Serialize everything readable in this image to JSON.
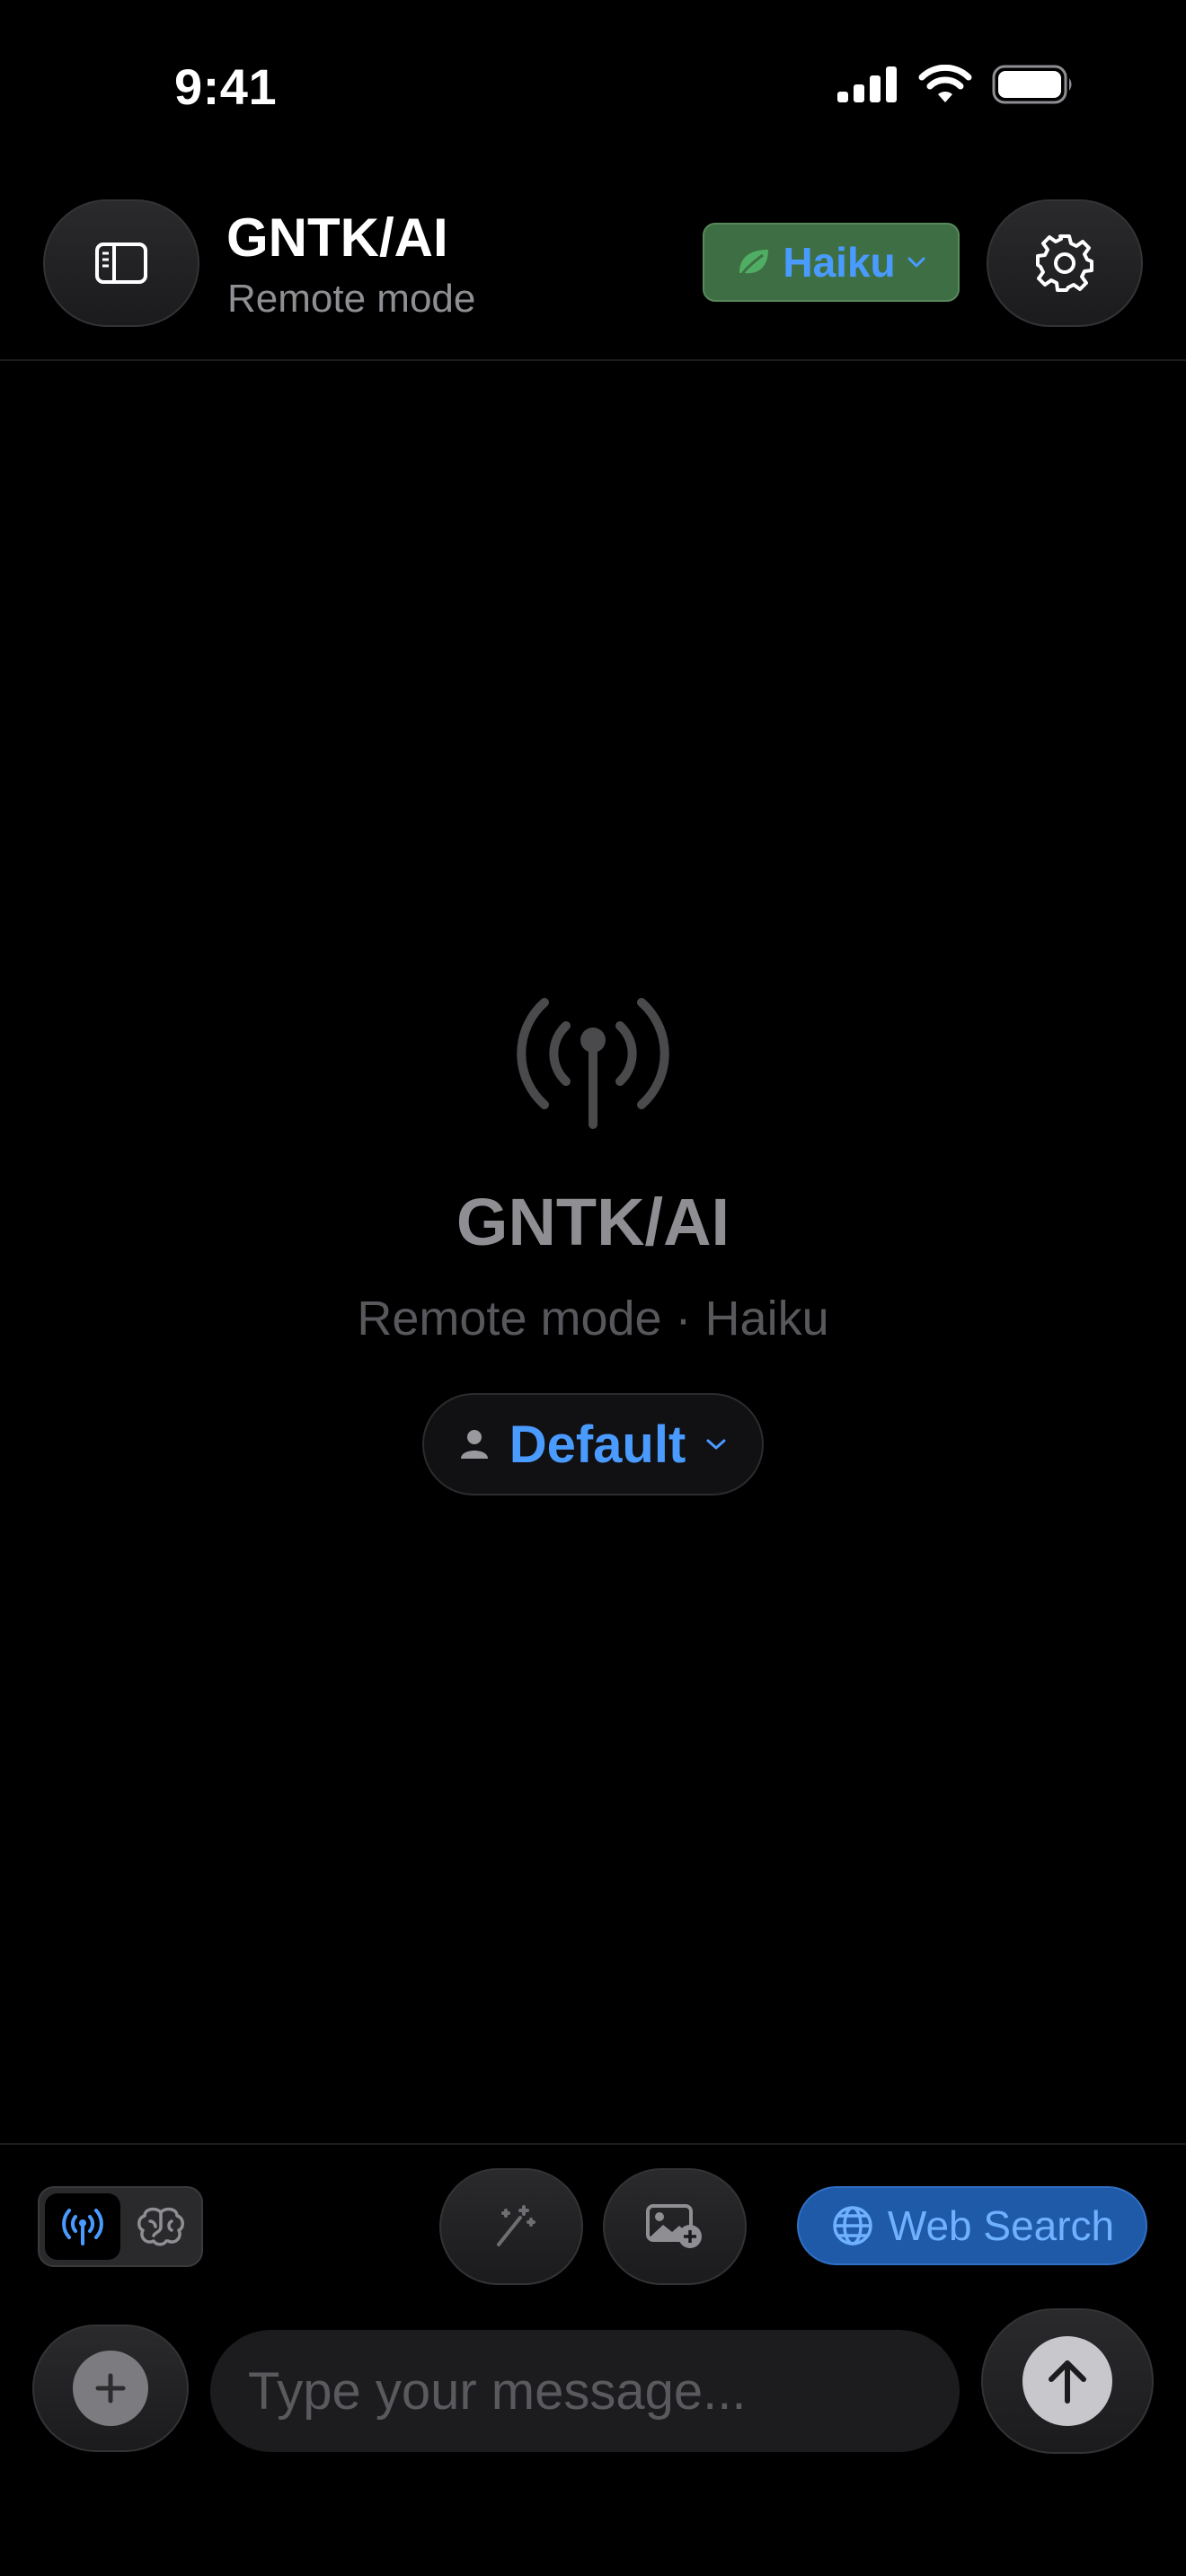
{
  "status_bar": {
    "time": "9:41",
    "icons": [
      "cellular-signal-icon",
      "wifi-icon",
      "battery-icon"
    ]
  },
  "header": {
    "title": "GNTK/AI",
    "subtitle": "Remote mode",
    "model": {
      "label": "Haiku",
      "icon": "leaf-icon",
      "color": "#4a9bff",
      "background": "#3e6f44"
    },
    "sidebar_icon": "sidebar-icon",
    "settings_icon": "gear-icon"
  },
  "empty_state": {
    "icon": "antenna-icon",
    "title": "GNTK/AI",
    "subtitle": "Remote mode · Haiku",
    "persona": {
      "label": "Default",
      "icon": "person-icon"
    }
  },
  "toolbar": {
    "mode_toggle": {
      "active": "remote-icon",
      "inactive": "brain-icon"
    },
    "enhance_icon": "magic-wand-icon",
    "image_icon": "add-photo-icon",
    "web_search": {
      "label": "Web Search",
      "icon": "globe-icon",
      "active": true
    }
  },
  "composer": {
    "placeholder": "Type your message...",
    "attach_icon": "plus-icon",
    "send_icon": "arrow-up-icon"
  },
  "colors": {
    "accent": "#4a9bff",
    "background": "#000000",
    "model_chip": "#3e6f44",
    "web_search": "#1f5aa8"
  }
}
